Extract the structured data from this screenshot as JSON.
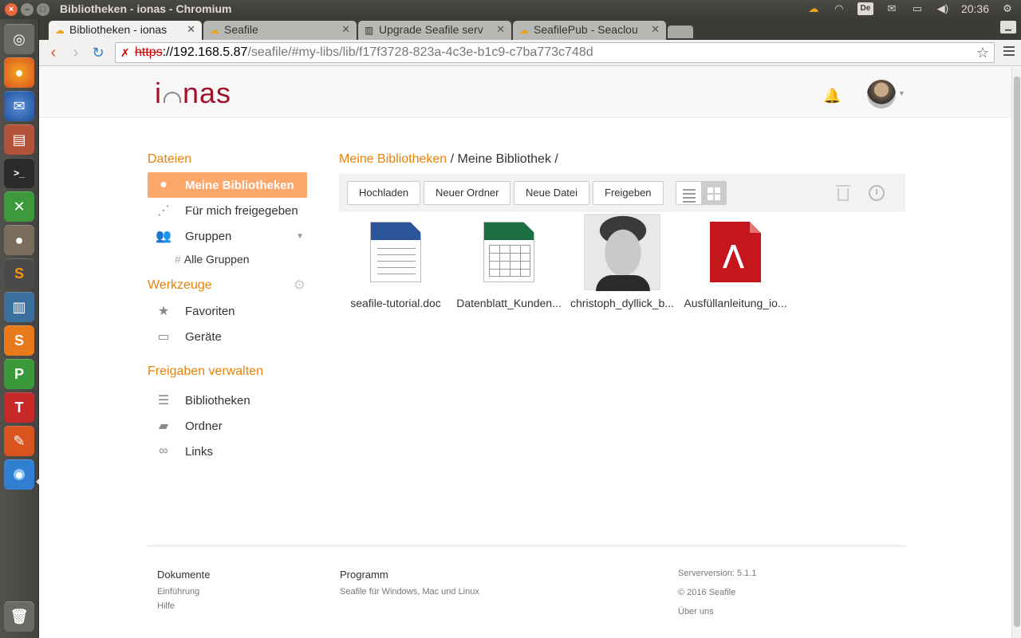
{
  "panel": {
    "window_title": "Bibliotheken - ionas - Chromium",
    "kbd_layout": "De",
    "clock": "20:36"
  },
  "tabs": [
    {
      "label": "Bibliotheken - ionas"
    },
    {
      "label": "Seafile"
    },
    {
      "label": "Upgrade Seafile serv"
    },
    {
      "label": "SeafilePub - Seaclou"
    }
  ],
  "address": {
    "scheme": "https",
    "host": "://192.168.5.87",
    "path": "/seafile/#my-libs/lib/f17f3728-823a-4c3e-b1c9-c7ba773c748d"
  },
  "logo": {
    "left": "i",
    "right": "nas"
  },
  "sidebar": {
    "files_heading": "Dateien",
    "my_libraries": "Meine Bibliotheken",
    "shared_with_me": "Für mich freigegeben",
    "groups": "Gruppen",
    "all_groups": "Alle Gruppen",
    "tools_heading": "Werkzeuge",
    "favorites": "Favoriten",
    "devices": "Geräte",
    "share_admin_heading": "Freigaben verwalten",
    "libraries": "Bibliotheken",
    "folders": "Ordner",
    "links": "Links"
  },
  "breadcrumb": {
    "root": "Meine Bibliotheken",
    "sep1": " / ",
    "current": "Meine Bibliothek",
    "sep2": " /"
  },
  "ops": {
    "upload": "Hochladen",
    "new_folder": "Neuer Ordner",
    "new_file": "Neue Datei",
    "share": "Freigeben"
  },
  "files": [
    {
      "name": "seafile-tutorial.doc",
      "type": "doc"
    },
    {
      "name": "Datenblatt_Kunden...",
      "type": "xls"
    },
    {
      "name": "christoph_dyllick_b...",
      "type": "image"
    },
    {
      "name": "Ausfüllanleitung_io...",
      "type": "pdf"
    }
  ],
  "footer": {
    "docs_heading": "Dokumente",
    "intro": "Einführung",
    "help": "Hilfe",
    "program_heading": "Programm",
    "clients": "Seafile für Windows, Mac und Linux",
    "server_version": "Serverversion: 5.1.1",
    "copyright": "© 2016 Seafile",
    "about": "Über uns"
  },
  "colors": {
    "accent": "#eb8205",
    "active_nav": "#fea76b",
    "logo": "#a0112b"
  }
}
